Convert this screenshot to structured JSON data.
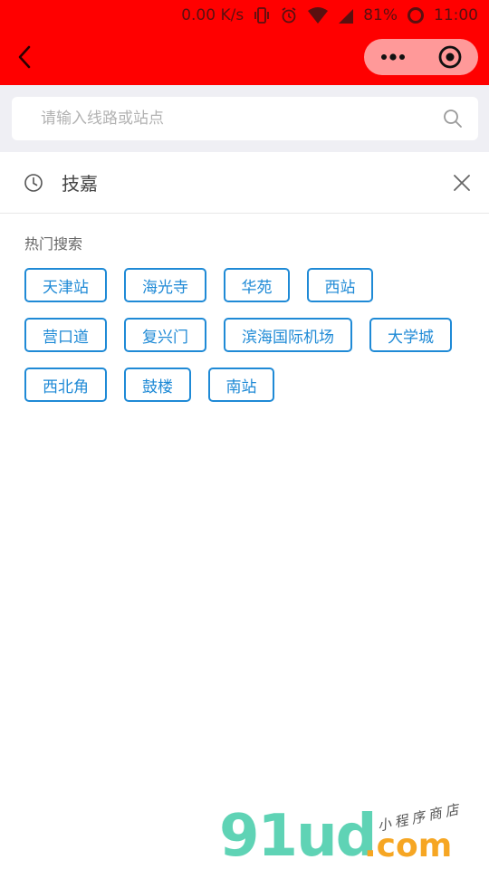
{
  "status_bar": {
    "speed": "0.00 K/s",
    "battery": "81%",
    "time": "11:00"
  },
  "nav": {
    "back_icon": "chevron-left-icon",
    "more_icon": "more-dots-icon",
    "close_icon": "target-circle-icon",
    "bar_color": "#ff0000"
  },
  "search": {
    "placeholder": "请输入线路或站点",
    "value": ""
  },
  "history": {
    "items": [
      {
        "label": "技嘉"
      }
    ]
  },
  "hot": {
    "title": "热门搜索",
    "rows": [
      [
        "天津站",
        "海光寺",
        "华苑",
        "西站"
      ],
      [
        "营口道",
        "复兴门",
        "滨海国际机场",
        "大学城"
      ],
      [
        "西北角",
        "鼓楼",
        "南站"
      ]
    ],
    "accent_color": "#1f8ad6"
  },
  "watermark": {
    "logo": "91ud",
    "domain": ".com",
    "sub": "小程序商店"
  }
}
